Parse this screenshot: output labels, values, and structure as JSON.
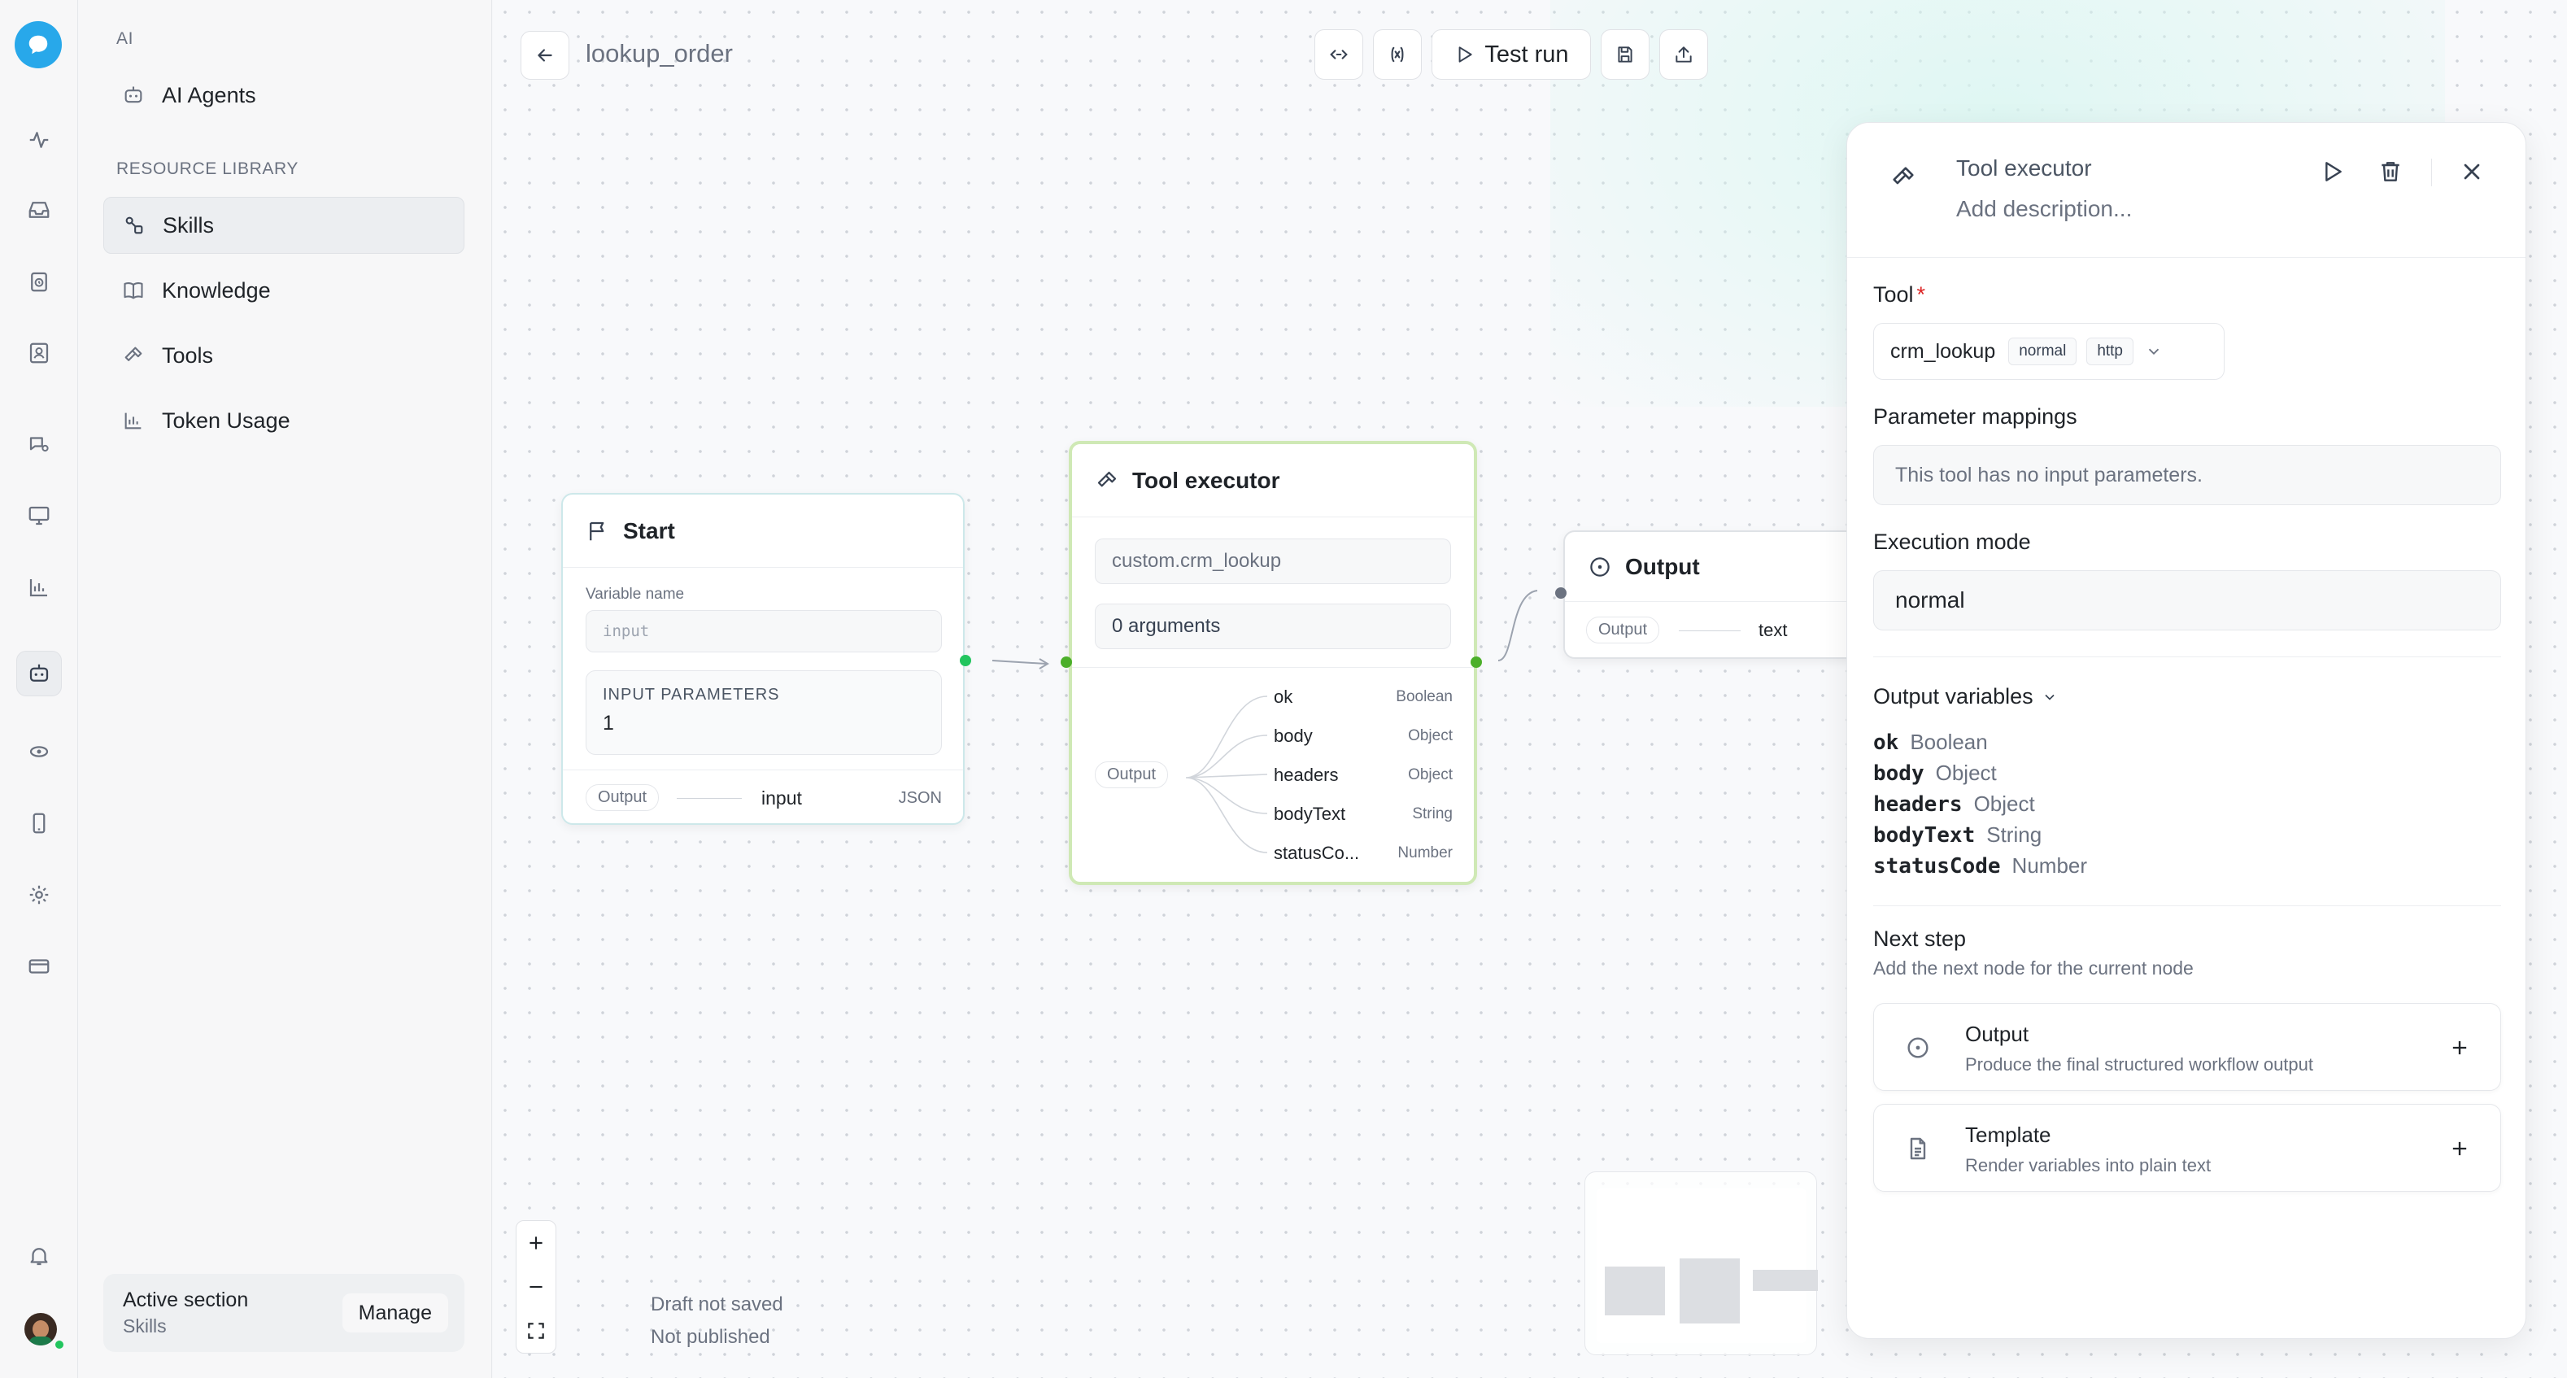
{
  "sidebar": {
    "section_ai": "AI",
    "ai_agents": "AI Agents",
    "section_resource": "RESOURCE LIBRARY",
    "items": [
      {
        "label": "Skills",
        "icon": "skills-icon"
      },
      {
        "label": "Knowledge",
        "icon": "book-icon"
      },
      {
        "label": "Tools",
        "icon": "hammer-icon"
      },
      {
        "label": "Token Usage",
        "icon": "bar-chart-icon"
      }
    ],
    "active_item": "Skills",
    "footer": {
      "title": "Active section",
      "subtitle": "Skills",
      "manage_label": "Manage"
    }
  },
  "header": {
    "workflow_title": "lookup_order",
    "test_run_label": "Test run"
  },
  "nodes": {
    "start": {
      "title": "Start",
      "variable_label": "Variable name",
      "variable_placeholder": "input",
      "params_label": "INPUT PARAMETERS",
      "params_value": "1",
      "output_tag": "Output",
      "output_name": "input",
      "output_type": "JSON"
    },
    "tool": {
      "title": "Tool executor",
      "tool_ref": "custom.crm_lookup",
      "arguments": "0 arguments",
      "output_tag": "Output",
      "outputs": [
        {
          "name": "ok",
          "type": "Boolean"
        },
        {
          "name": "body",
          "type": "Object"
        },
        {
          "name": "headers",
          "type": "Object"
        },
        {
          "name": "bodyText",
          "type": "String"
        },
        {
          "name": "statusCo...",
          "type": "Number"
        }
      ]
    },
    "output": {
      "title": "Output",
      "output_tag": "Output",
      "output_type": "text"
    }
  },
  "status": {
    "draft": "Draft not saved",
    "published": "Not published"
  },
  "panel": {
    "title": "Tool executor",
    "description_placeholder": "Add description...",
    "tool_label": "Tool",
    "required_mark": "*",
    "tool_name": "crm_lookup",
    "tool_badges": [
      "normal",
      "http"
    ],
    "param_label": "Parameter mappings",
    "param_empty": "This tool has no input parameters.",
    "mode_label": "Execution mode",
    "mode_value": "normal",
    "output_vars_label": "Output variables",
    "output_vars": [
      {
        "name": "ok",
        "type": "Boolean"
      },
      {
        "name": "body",
        "type": "Object"
      },
      {
        "name": "headers",
        "type": "Object"
      },
      {
        "name": "bodyText",
        "type": "String"
      },
      {
        "name": "statusCode",
        "type": "Number"
      }
    ],
    "next_step_label": "Next step",
    "next_step_desc": "Add the next node for the current node",
    "next_options": [
      {
        "title": "Output",
        "desc": "Produce the final structured workflow output",
        "icon": "circle-output-icon"
      },
      {
        "title": "Template",
        "desc": "Render variables into plain text",
        "icon": "document-icon"
      }
    ]
  },
  "colors": {
    "accent_green": "#22c55e",
    "tool_node_border": "#cfe9b5",
    "start_node_border": "#cde8ea",
    "required": "#dc2626",
    "logo_blue": "#28a8ea"
  }
}
